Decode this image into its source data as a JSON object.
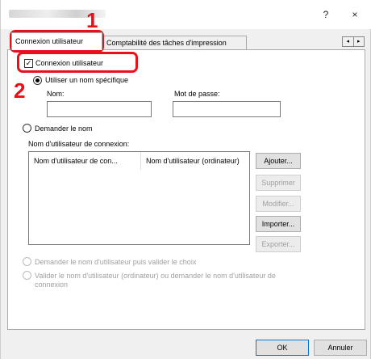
{
  "window": {
    "help_glyph": "?",
    "close_glyph": "×"
  },
  "tabs": [
    {
      "label": "Connexion utilisateur"
    },
    {
      "label": "Comptabilité des tâches d'impression"
    }
  ],
  "tab_scroll": {
    "left": "◂",
    "right": "▸"
  },
  "login": {
    "checkbox_label": "Connexion utilisateur",
    "checkbox_mark": "✓",
    "radio_specific": "Utiliser un nom spécifique",
    "name_label": "Nom:",
    "password_label": "Mot de passe:",
    "name_value": "",
    "password_value": "",
    "radio_ask": "Demander le nom",
    "list_label": "Nom d'utilisateur de connexion:",
    "columns": [
      "Nom d'utilisateur de con...",
      "Nom d'utilisateur (ordinateur)"
    ],
    "radio_ask_validate": "Demander le nom d'utilisateur puis valider le choix",
    "radio_validate_pc_1": "Valider le nom d'utilisateur (ordinateur) ou demander le nom d'utilisateur de",
    "radio_validate_pc_2": "connexion"
  },
  "side_buttons": {
    "add": "Ajouter...",
    "delete": "Supprimer",
    "modify": "Modifier...",
    "import": "Importer...",
    "export": "Exporter..."
  },
  "footer": {
    "ok": "OK",
    "cancel": "Annuler"
  },
  "callouts": {
    "step1": "1",
    "step2": "2",
    "color": "#e8101a"
  }
}
